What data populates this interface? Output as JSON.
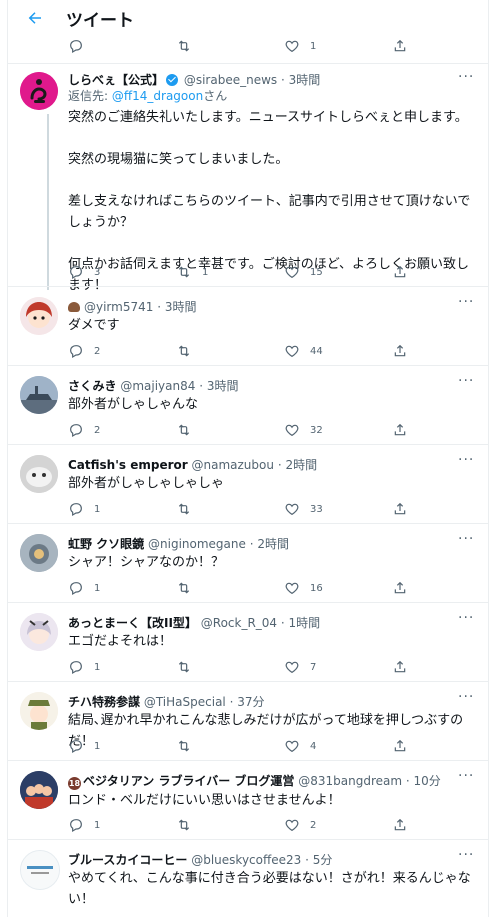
{
  "header": {
    "title": "ツイート"
  },
  "top_actions": {
    "reply_count": "",
    "retweet_count": "",
    "like_count": "1"
  },
  "main_tweet": {
    "name": "しらべぇ【公式】",
    "handle": "@sirabee_news",
    "time": "· 3時間",
    "reply_prefix": "返信先: ",
    "reply_mention": "@ff14_dragoon",
    "reply_suffix": "さん",
    "text": "突然のご連絡失礼いたします。ニュースサイトしらべぇと申します。\n\n突然の現場猫に笑ってしまいました。\n\n差し支えなければこちらのツイート、記事内で引用させて頂けないでしょうか？\n\n何点かお話伺えますと幸甚です。ご検討のほど、よろしくお願い致します！",
    "reply_count": "3",
    "retweet_count": "1",
    "like_count": "15",
    "avatar_color": "#e0198c"
  },
  "replies": [
    {
      "name": "",
      "handle": "@yirm5741",
      "time": "· 3時間",
      "text": "ダメです",
      "reply_count": "2",
      "retweet_count": "",
      "like_count": "44",
      "avatar_color": "#c0392b"
    },
    {
      "name": "さくみき",
      "handle": "@majiyan84",
      "time": "· 3時間",
      "text": "部外者がしゃしゃんな",
      "reply_count": "2",
      "retweet_count": "",
      "like_count": "32",
      "avatar_color": "#5d6d7e"
    },
    {
      "name": "Catfish's emperor",
      "handle": "@namazubou",
      "time": "· 2時間",
      "text": "部外者がしゃしゃしゃしゃ",
      "reply_count": "1",
      "retweet_count": "",
      "like_count": "33",
      "avatar_color": "#a9a9a9"
    },
    {
      "name": "虹野 クソ眼鏡",
      "handle": "@niginomegane",
      "time": "· 2時間",
      "text": "シャア！シャアなのか！？",
      "reply_count": "1",
      "retweet_count": "",
      "like_count": "16",
      "avatar_color": "#7f8c8d"
    },
    {
      "name": "あっとまーく【改II型】",
      "handle": "@Rock_R_04",
      "time": "· 1時間",
      "text": "エゴだよそれは！",
      "reply_count": "1",
      "retweet_count": "",
      "like_count": "7",
      "avatar_color": "#b8b0c8"
    },
    {
      "name": "チハ特務参謀",
      "handle": "@TiHaSpecial",
      "time": "· 37分",
      "text": "結局､遅かれ早かれこんな悲しみだけが広がって地球を押しつぶすのだ！",
      "reply_count": "1",
      "retweet_count": "",
      "like_count": "4",
      "avatar_color": "#6b7b3a"
    },
    {
      "name": "ベジタリアン ラブライバー ブログ運営",
      "badge": "18",
      "handle": "@831bangdream",
      "time": "· 10分",
      "text": "ロンド・ベルだけにいい思いはさせませんよ！",
      "reply_count": "1",
      "retweet_count": "",
      "like_count": "2",
      "avatar_color": "#2c3e66"
    },
    {
      "name": "ブルースカイコーヒー",
      "handle": "@blueskycoffee23",
      "time": "· 5分",
      "text": "やめてくれ、こんな事に付き合う必要はない！さがれ！来るんじゃない！",
      "reply_count": "",
      "retweet_count": "",
      "like_count": "",
      "avatar_color": "#f4f6f8"
    }
  ]
}
